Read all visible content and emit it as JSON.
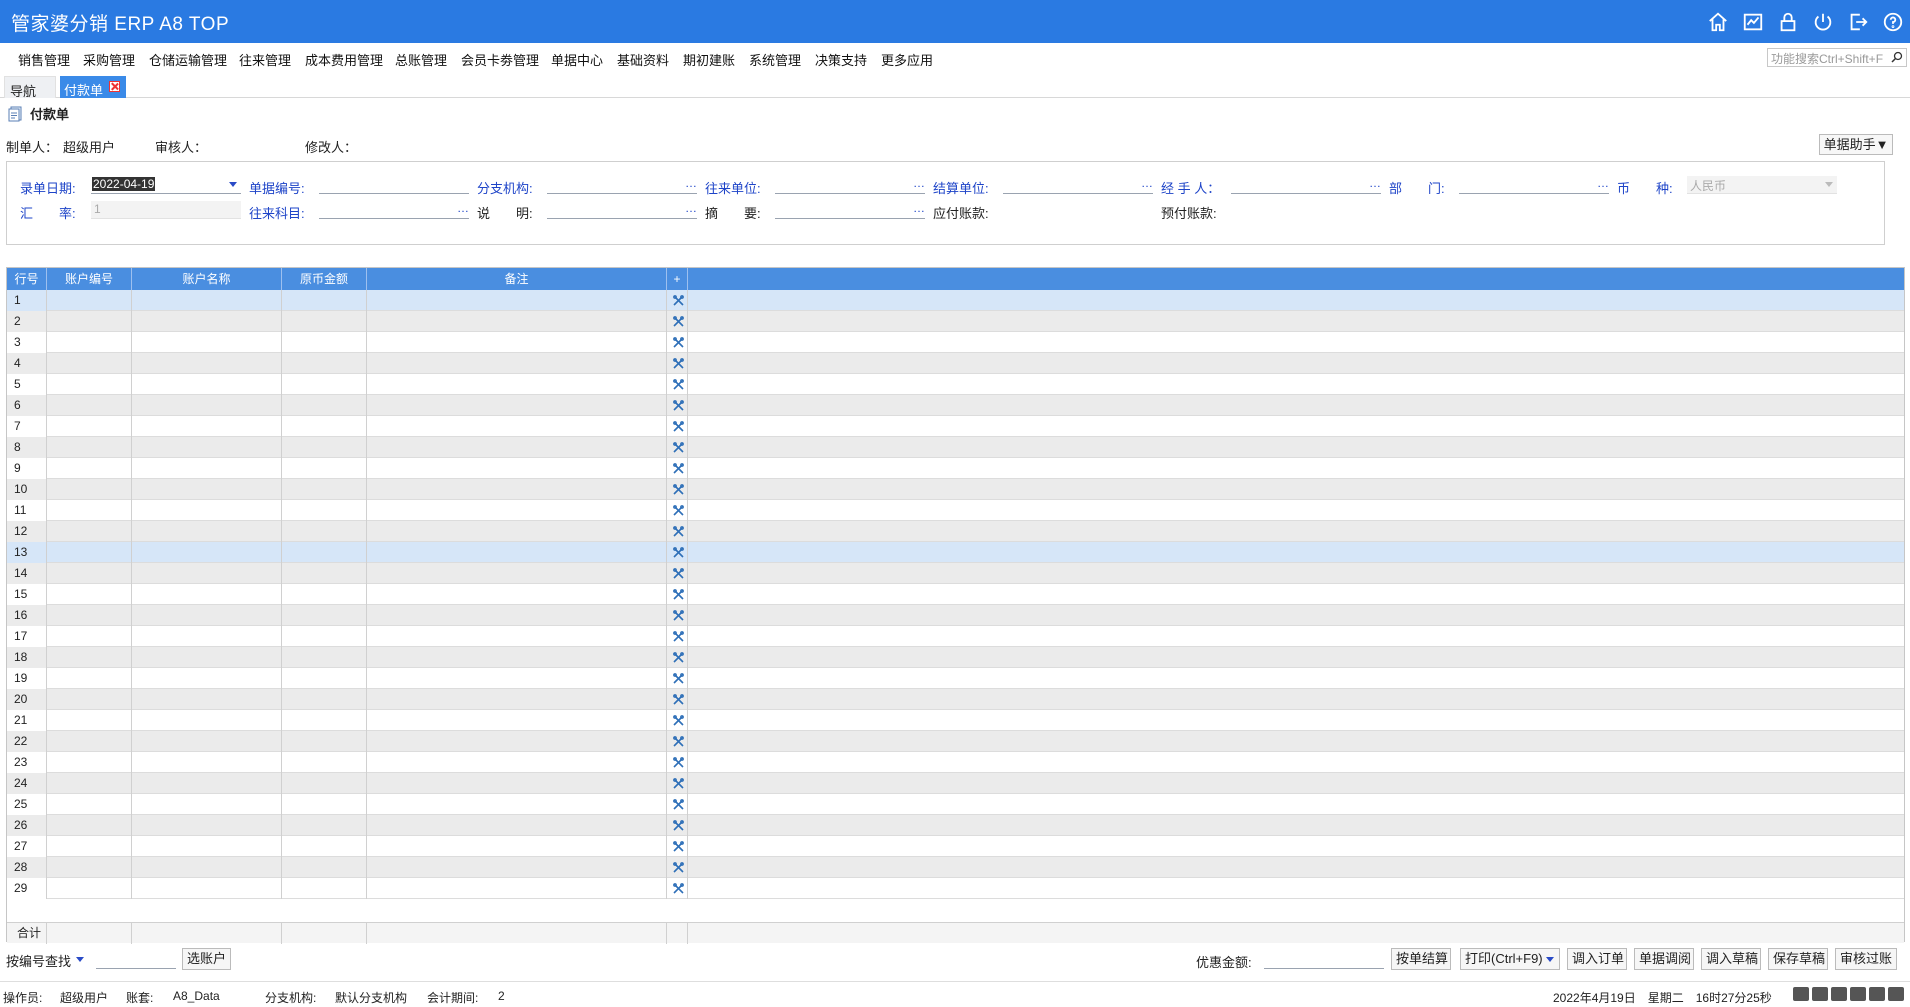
{
  "app": {
    "title": "管家婆分销 ERP A8 TOP"
  },
  "top_icons": [
    "home-icon",
    "chart-icon",
    "lock-icon",
    "power-icon",
    "exit-icon",
    "help-icon"
  ],
  "menu": {
    "items": [
      "销售管理",
      "采购管理",
      "仓储运输管理",
      "往来管理",
      "成本费用管理",
      "总账管理",
      "会员卡劵管理",
      "单据中心",
      "基础资料",
      "期初建账",
      "系统管理",
      "决策支持",
      "更多应用"
    ],
    "search_placeholder": "功能搜索Ctrl+Shift+F"
  },
  "tabs": {
    "nav": "导航",
    "active": "付款单"
  },
  "document": {
    "title": "付款单",
    "creator_label": "制单人：",
    "creator_value": "超级用户",
    "reviewer_label": "审核人：",
    "modifier_label": "修改人：",
    "helper_button": "单据助手▼"
  },
  "form": {
    "date_label": "录单日期:",
    "date_value": "2022-04-19",
    "docno_label": "单据编号:",
    "branch_label": "分支机构:",
    "partner_label": "往来单位:",
    "settle_label": "结算单位:",
    "handler_label": "经 手 人：",
    "dept_label": "部　　门:",
    "currency_label": "币　　种:",
    "currency_value": "人民币",
    "rate_label": "汇　　率:",
    "rate_value": "1",
    "subject_label": "往来科目:",
    "desc_label": "说　　明:",
    "summary_label": "摘　　要:",
    "payable_label": "应付账款:",
    "prepaid_label": "预付账款:",
    "ellipsis": "…"
  },
  "grid": {
    "columns": [
      "行号",
      "账户编号",
      "账户名称",
      "原币金额",
      "备注",
      "+"
    ],
    "rows": [
      "1",
      "2",
      "3",
      "4",
      "5",
      "6",
      "7",
      "8",
      "9",
      "10",
      "11",
      "12",
      "13",
      "14",
      "15",
      "16",
      "17",
      "18",
      "19",
      "20",
      "21",
      "22",
      "23",
      "24",
      "25",
      "26",
      "27",
      "28",
      "29"
    ],
    "footer_label": "合计"
  },
  "bottom": {
    "find_mode": "按编号查找",
    "select_account": "选账户",
    "discount_label": "优惠金额:",
    "buttons": [
      "按单结算",
      "打印(Ctrl+F9)",
      "调入订单",
      "单据调阅",
      "调入草稿",
      "保存草稿",
      "审核过账"
    ]
  },
  "status": {
    "operator_label": "操作员:",
    "operator_value": "超级用户",
    "account_label": "账套:",
    "account_value": "A8_Data",
    "branch_label": "分支机构:",
    "branch_value": "默认分支机构",
    "period_label": "会计期间:",
    "period_value": "2",
    "datetime": "2022年4月19日　星期二　16时27分25秒"
  },
  "colors": {
    "titlebar": "#2a7ae2",
    "grid_header": "#4a8ee0",
    "label_blue": "#1e44c8"
  }
}
